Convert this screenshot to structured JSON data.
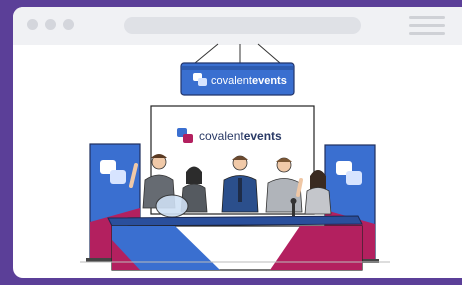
{
  "brand": {
    "name_regular": "covalent",
    "name_bold": "events"
  },
  "browser": {
    "controls": [
      "window-dot",
      "window-dot",
      "window-dot"
    ],
    "menu_icon": "hamburger-icon"
  },
  "colors": {
    "frame": "#5b3f98",
    "blue": "#3a6fd0",
    "magenta": "#b3205f",
    "dark_blue": "#2a4f9c"
  }
}
